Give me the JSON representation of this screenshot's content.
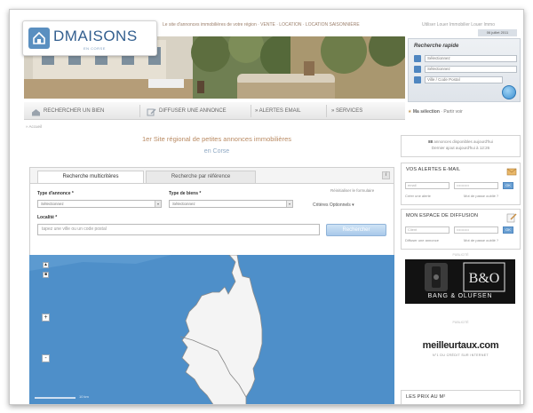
{
  "header": {
    "brand": "DMAISONS",
    "brand_sub": "EN CORSE",
    "tagline": "Le site d'annonces immobilières de votre région · VENTE · LOCATION · LOCATION SAISONNIÈRE",
    "top_links": "Utiliser Louer Immobilier Louer Immo",
    "date": "06 juillet 2011"
  },
  "quick_search": {
    "title": "Recherche rapide",
    "rows": [
      "Sélectionnez",
      "Sélectionnez",
      "Ville / Code Postal"
    ]
  },
  "nav": {
    "items": [
      "RECHERCHER UN BIEN",
      "DIFFUSER UNE ANNONCE",
      "» ALERTES EMAIL",
      "» SERVICES"
    ],
    "my_selection": "Ma sélection",
    "favorites": "Partir voir"
  },
  "breadcrumb": "» Accueil",
  "heading": {
    "line1": "1er Site régional de petites annonces immobilières",
    "line2": "en Corse"
  },
  "search": {
    "tabs": [
      "Recherche multicritères",
      "Recherche par référence"
    ],
    "info": "i",
    "type_annonce_label": "Type d'annonce *",
    "type_annonce_value": "Sélectionnez",
    "type_bien_label": "Type de biens *",
    "type_bien_value": "Sélectionnez",
    "reset_link": "Réinitialiser le formulaire",
    "criteria": "Critères Optionnels ▾",
    "locality_label": "Localité *",
    "locality_placeholder": "tapez une ville ou un code postal",
    "submit": "Rechercher"
  },
  "map": {
    "zoom_in": "+",
    "zoom_out": "-",
    "scale": "10 km"
  },
  "sidebar": {
    "count_number": "88",
    "count_text": "annonces disponibles aujourd'hui",
    "count_update": "Dernier ajout aujourd'hui à 12:26",
    "alerts_title": "VOS ALERTES E-MAIL",
    "alerts_input1": "email",
    "alerts_input2": "••••••••••",
    "alerts_btn": "OK",
    "alerts_link1": "Créer une alerte",
    "alerts_link2": "Mot de passe oublié ?",
    "diffusion_title": "MON ESPACE DE DIFFUSION",
    "diffusion_input1": "Client",
    "diffusion_input2": "••••••••••",
    "diffusion_btn": "OK",
    "diffusion_link1": "Diffuser une annonce",
    "diffusion_link2": "Mot de passe oublié ?",
    "ad1_label": "PUBLICITÉ",
    "ad1_brand": "BANG & OLUFSEN",
    "ad1_logo": "B&O",
    "ad2_label": "PUBLICITÉ",
    "ad2_brand": "meilleurtaux.com",
    "ad2_sub": "N°1 DU CRÉDIT SUR INTERNET",
    "prices_title": "LES PRIX AU M²"
  },
  "colors": {
    "brand_blue": "#335f8f",
    "sea": "#4e8fc9",
    "island": "#f4f4f4",
    "heading_accent": "#b98a62"
  }
}
